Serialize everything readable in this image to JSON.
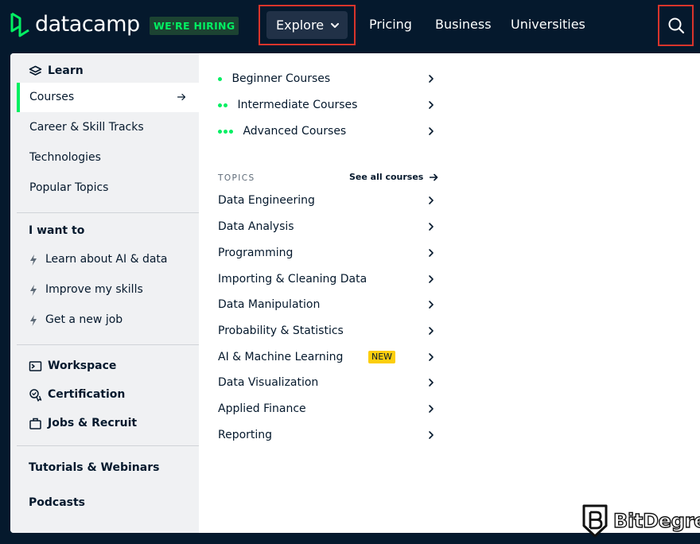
{
  "header": {
    "logo_text": "datacamp",
    "hiring_badge": "WE'RE HIRING",
    "nav": {
      "explore": "Explore",
      "pricing": "Pricing",
      "business": "Business",
      "universities": "Universities"
    },
    "icons": {
      "logo": "datacamp-logo-icon",
      "dropdown": "chevron-down-icon",
      "search": "search-icon"
    }
  },
  "sidebar": {
    "learn_title": "Learn",
    "learn_items": [
      "Courses",
      "Career & Skill Tracks",
      "Technologies",
      "Popular Topics"
    ],
    "active_item": "Courses",
    "want_title": "I want to",
    "want_items": [
      "Learn about AI & data",
      "Improve my skills",
      "Get a new job"
    ],
    "tools": [
      "Workspace",
      "Certification",
      "Jobs & Recruit"
    ],
    "extra": [
      "Tutorials & Webinars",
      "Podcasts"
    ]
  },
  "courses": {
    "levels": [
      {
        "label": "Beginner Courses",
        "dots": 1
      },
      {
        "label": "Intermediate Courses",
        "dots": 2
      },
      {
        "label": "Advanced Courses",
        "dots": 3
      }
    ],
    "topics_label": "TOPICS",
    "see_all": "See all courses",
    "topics": [
      "Data Engineering",
      "Data Analysis",
      "Programming",
      "Importing & Cleaning Data",
      "Data Manipulation",
      "Probability & Statistics",
      "AI & Machine Learning",
      "Data Visualization",
      "Applied Finance",
      "Reporting"
    ],
    "new_badge": "NEW"
  },
  "watermark": {
    "text": "BitDegree"
  },
  "colors": {
    "navy": "#05192d",
    "green": "#03ef62",
    "highlight_border": "#d9342b",
    "new_badge": "#fcce0d"
  }
}
